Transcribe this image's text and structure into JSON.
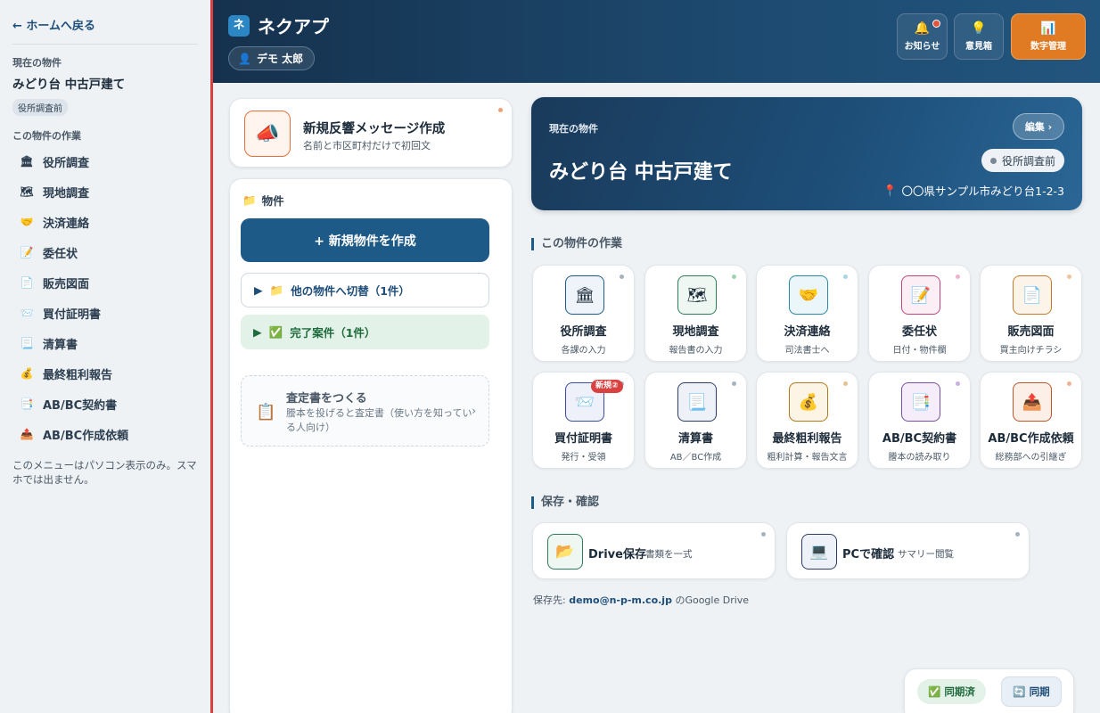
{
  "sidebar": {
    "back_label": "← ホームへ戻る",
    "current_label": "現在の物件",
    "property_name": "みどり台 中古戸建て",
    "status_badge": "役所調査前",
    "section_label": "この物件の作業",
    "items": [
      {
        "label": "役所調査",
        "icon": "🏛"
      },
      {
        "label": "現地調査",
        "icon": "🗺"
      },
      {
        "label": "決済連絡",
        "icon": "🤝"
      },
      {
        "label": "委任状",
        "icon": "📝"
      },
      {
        "label": "販売図面",
        "icon": "📄"
      },
      {
        "label": "買付証明書",
        "icon": "📨"
      },
      {
        "label": "清算書",
        "icon": "📃"
      },
      {
        "label": "最終粗利報告",
        "icon": "💰"
      },
      {
        "label": "AB/BC契約書",
        "icon": "📑"
      },
      {
        "label": "AB/BC作成依頼",
        "icon": "📤"
      }
    ],
    "note": "このメニューはパソコン表示のみ。スマホでは出ません。"
  },
  "header": {
    "logo_char": "ネ",
    "app_title": "ネクアプ",
    "user_name": "デモ 太郎",
    "buttons": {
      "notify": "お知らせ",
      "opinion": "意見箱",
      "numbers": "数字管理"
    }
  },
  "broadcast": {
    "title": "新規反響メッセージ作成",
    "subtitle": "名前と市区町村だけで初回文"
  },
  "property_panel": {
    "heading": "物件",
    "new_button": "+ 新規物件を作成",
    "switch_label": "他の物件へ切替（1件）",
    "done_label": "完了案件（1件）",
    "satei_title": "査定書をつくる",
    "satei_sub": "謄本を投げると査定書（使い方を知っている人向け）",
    "satei_chevron": "›"
  },
  "hero": {
    "label": "現在の物件",
    "title": "みどり台 中古戸建て",
    "edit_label": "編集 ›",
    "status": "役所調査前",
    "address": "〇〇県サンプル市みどり台1-2-3"
  },
  "tasks_section": {
    "title": "この物件の作業",
    "tasks": [
      {
        "title": "役所調査",
        "sub": "各課の入力",
        "icon": "🏛",
        "color": "#1e5a87",
        "bg": "#eef4f9"
      },
      {
        "title": "現地調査",
        "sub": "報告書の入力",
        "icon": "🗺",
        "color": "#2e7d5a",
        "bg": "#eef7f1"
      },
      {
        "title": "決済連絡",
        "sub": "司法書士へ",
        "icon": "🤝",
        "color": "#2a8aa8",
        "bg": "#eaf6fa"
      },
      {
        "title": "委任状",
        "sub": "日付・物件欄",
        "icon": "📝",
        "color": "#c2457e",
        "bg": "#fbeef4"
      },
      {
        "title": "販売図面",
        "sub": "買主向けチラシ",
        "icon": "📄",
        "color": "#c77a2a",
        "bg": "#fcf3e9"
      },
      {
        "title": "買付証明書",
        "sub": "発行・受領",
        "icon": "📨",
        "color": "#3a4ea0",
        "bg": "#eef0fa",
        "badge": "新規②"
      },
      {
        "title": "清算書",
        "sub": "AB／BC作成",
        "icon": "📃",
        "color": "#2c3e66",
        "bg": "#eef1f7"
      },
      {
        "title": "最終粗利報告",
        "sub": "粗利計算・報告文言",
        "icon": "💰",
        "color": "#b07a1a",
        "bg": "#fcf4e4"
      },
      {
        "title": "AB/BC契約書",
        "sub": "謄本の読み取り",
        "icon": "📑",
        "color": "#7a4ea0",
        "bg": "#f5eefa"
      },
      {
        "title": "AB/BC作成依頼",
        "sub": "総務部への引継ぎ",
        "icon": "📤",
        "color": "#c0562a",
        "bg": "#fcefe8"
      }
    ]
  },
  "save_section": {
    "title": "保存・確認",
    "drive_title": "Drive保存",
    "drive_sub": "書類を一式",
    "pc_title": "PCで確認",
    "pc_sub": "サマリー閲覧",
    "dest_prefix": "保存先:",
    "dest_email": "demo@n-p-m.co.jp",
    "dest_suffix": "のGoogle Drive"
  },
  "sync": {
    "status": "同期済",
    "button": "同期"
  }
}
